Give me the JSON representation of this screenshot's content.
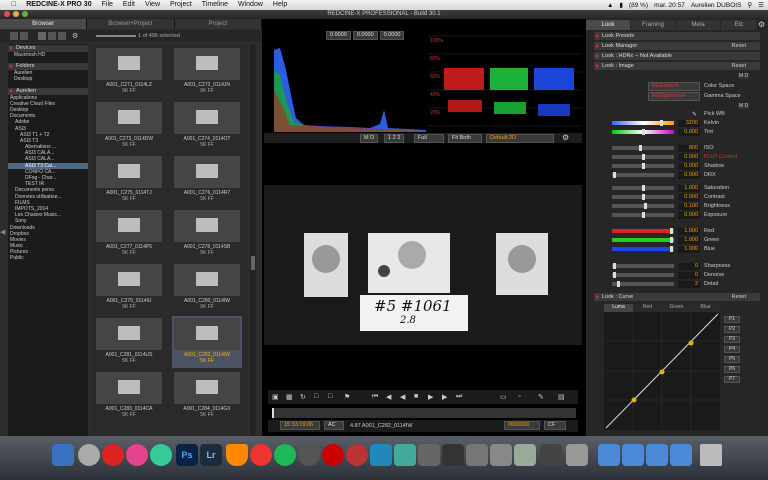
{
  "menubar": {
    "apple": "",
    "items": [
      "REDCINE-X PRO 30",
      "File",
      "Edit",
      "View",
      "Project",
      "Timeline",
      "Window",
      "Help"
    ],
    "battery": "(89 %)",
    "clock": "mar. 20:57",
    "user": "Aurelien DUBOIS"
  },
  "window": {
    "title": "REDCINE-X PROFESSIONAL - Build 30.1"
  },
  "left_tabs": [
    "Browser",
    "Browser+Project",
    "Project"
  ],
  "browser": {
    "selection_count": "1 of 496 selected",
    "sections": {
      "devices": "Devices",
      "folders": "Folders",
      "user": "Aurelien"
    },
    "devices": [
      "Macintosh HD"
    ],
    "folders": [
      "Aurelien",
      "Desktop"
    ],
    "tree": [
      "Applications",
      "Creative Cloud Files",
      "Desktop",
      "Documents",
      "Adobe",
      "ASI3",
      "ASI3 T1 + T2",
      "ASI3 T3",
      "Aberrations ...",
      "ASI3 CALA...",
      "ASI3 CALA...",
      "ASI3 T3 Cal...",
      "CONFO CA...",
      "DFog - Char...",
      "TEST IR",
      "Documents perso",
      "Données utilisateur...",
      "FILMS",
      "IMPOTS_2014",
      "Les Chaises Music...",
      "Sony",
      "Downloads",
      "Dropbox",
      "Movies",
      "Music",
      "Pictures",
      "Public"
    ],
    "selected_tree_index": 11
  },
  "clips": [
    {
      "name": "A001_C271_0114LZ",
      "fmt": "5K FF"
    },
    {
      "name": "A001_C272_0114JN",
      "fmt": "5K FF"
    },
    {
      "name": "A001_C273_0114DW",
      "fmt": "5K FF"
    },
    {
      "name": "A001_C274_0114OT",
      "fmt": "5K FF"
    },
    {
      "name": "A001_C275_0114TJ",
      "fmt": "5K FF"
    },
    {
      "name": "A001_C276_0114R7",
      "fmt": "5K FF"
    },
    {
      "name": "A001_C277_0114P5",
      "fmt": "5K FF"
    },
    {
      "name": "A001_C278_0114SB",
      "fmt": "5K FF"
    },
    {
      "name": "A001_C279_0114IU",
      "fmt": "5K FF"
    },
    {
      "name": "A001_C280_0114IW",
      "fmt": "5K FF"
    },
    {
      "name": "A001_C281_0114US",
      "fmt": "5K FF"
    },
    {
      "name": "A001_C282_0114IW",
      "fmt": "5K FF",
      "selected": true
    },
    {
      "name": "A001_C283_0114CA",
      "fmt": "5K FF"
    },
    {
      "name": "A001_C284_0114GX",
      "fmt": "5K FF"
    }
  ],
  "scopes": {
    "readouts": [
      "0.0000",
      "0.0000",
      "0.0000"
    ],
    "wave_ticks": [
      "100%",
      "80%",
      "60%",
      "40%",
      "20%",
      "0%"
    ]
  },
  "viewbar": {
    "md": "M D",
    "frac": "1 2 3",
    "full": "Full",
    "fit": "Fit Both",
    "default2d": "Default 2D"
  },
  "viewer": {
    "slate_text": "#5 #1061",
    "slate_sub": "2.8"
  },
  "timecode": {
    "tc": "15:33:19:06",
    "ac": "AC",
    "clip": "4.87 A001_C282_0114IW",
    "frame": "0000000",
    "cf": "CF"
  },
  "right_tabs": [
    "Look",
    "Framing",
    "Meta",
    "Etc"
  ],
  "look": {
    "presets": "Look Presets",
    "manager": "Look Manager",
    "hdrx": "Look : HDRx -- Not Available",
    "image": "Look : Image",
    "reset": "Reset",
    "md": "M D",
    "color_space_value": "REDcolor4",
    "color_space": "Color Space",
    "gamma_value": "REDgamma4",
    "gamma_space": "Gamma Space",
    "pick_wb": "Pick WB",
    "curve": "Look : Curve"
  },
  "adjust": [
    {
      "label": "Kelvin",
      "value": "3200"
    },
    {
      "label": "Tint",
      "value": "0.000"
    },
    {
      "label": "ISO",
      "value": "800"
    },
    {
      "label": "FLUT Control",
      "value": "0.000"
    },
    {
      "label": "Shadow",
      "value": "0.000"
    },
    {
      "label": "DRX",
      "value": "0.000"
    },
    {
      "label": "Saturation",
      "value": "1.000"
    },
    {
      "label": "Contrast",
      "value": "0.000"
    },
    {
      "label": "Brightness",
      "value": "0.100"
    },
    {
      "label": "Exposure",
      "value": "0.000"
    },
    {
      "label": "Red",
      "value": "1.000"
    },
    {
      "label": "Green",
      "value": "1.000"
    },
    {
      "label": "Blue",
      "value": "1.000"
    },
    {
      "label": "Sharpness",
      "value": "0"
    },
    {
      "label": "Denoise",
      "value": "0"
    },
    {
      "label": "Detail",
      "value": "2"
    }
  ],
  "curve_tabs": [
    "Luma",
    "Red",
    "Green",
    "Blue"
  ],
  "presets_p": [
    "P1",
    "P2",
    "P3",
    "P4",
    "P5",
    "P6",
    "P7"
  ],
  "colors": {
    "accent": "#f0a000",
    "red": "#e02020",
    "green": "#20c020",
    "blue": "#2040e0"
  }
}
